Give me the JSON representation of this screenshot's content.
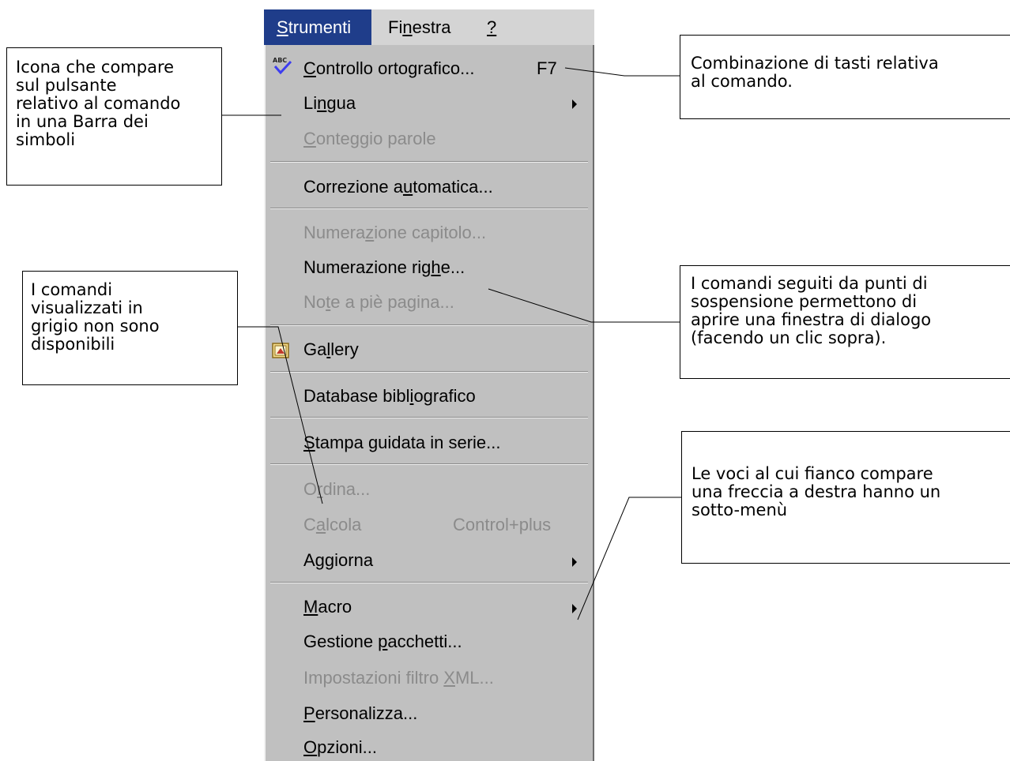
{
  "menubar": {
    "strumenti": {
      "pre": "",
      "u": "S",
      "post": "trumenti"
    },
    "finestra": {
      "pre": "Fi",
      "u": "n",
      "post": "estra"
    },
    "help": {
      "pre": "",
      "u": "?",
      "post": ""
    }
  },
  "menu": {
    "items": [
      {
        "pre": "",
        "u": "C",
        "post": "ontrollo ortografico...",
        "shortcut": "F7",
        "disabled": false,
        "icon": "abc-spellcheck-icon"
      },
      {
        "pre": "Li",
        "u": "n",
        "post": "gua",
        "disabled": false,
        "submenu": true
      },
      {
        "pre": "",
        "u": "C",
        "post": "onteggio parole",
        "disabled": true
      },
      {
        "pre": "Correzione a",
        "u": "u",
        "post": "tomatica...",
        "disabled": false
      },
      {
        "pre": "Numera",
        "u": "z",
        "post": "ione capitolo...",
        "disabled": true
      },
      {
        "pre": "Numerazione rig",
        "u": "h",
        "post": "e...",
        "disabled": false
      },
      {
        "pre": "No",
        "u": "t",
        "post": "e a piè pagina...",
        "disabled": true
      },
      {
        "pre": "Ga",
        "u": "l",
        "post": "lery",
        "disabled": false,
        "icon": "gallery-icon"
      },
      {
        "pre": "Database bibl",
        "u": "i",
        "post": "ografico",
        "disabled": false
      },
      {
        "pre": "",
        "u": "S",
        "post": "tampa guidata in serie...",
        "disabled": false
      },
      {
        "pre": "O",
        "u": "r",
        "post": "dina...",
        "disabled": true
      },
      {
        "pre": "C",
        "u": "a",
        "post": "lcola",
        "shortcut": "Control+plus",
        "disabled": true
      },
      {
        "pre": "Aggiorna",
        "u": "",
        "post": "",
        "disabled": false,
        "submenu": true
      },
      {
        "pre": "",
        "u": "M",
        "post": "acro",
        "disabled": false,
        "submenu": true
      },
      {
        "pre": "Gestione ",
        "u": "p",
        "post": "acchetti...",
        "disabled": false
      },
      {
        "pre": "Impostazioni filtro ",
        "u": "X",
        "post": "ML...",
        "disabled": true
      },
      {
        "pre": "",
        "u": "P",
        "post": "ersonalizza...",
        "disabled": false
      },
      {
        "pre": "",
        "u": "O",
        "post": "pzioni...",
        "disabled": false
      }
    ]
  },
  "callouts": {
    "icon_note": "Icona che compare\nsul pulsante\nrelativo al comando\nin una Barra dei\nsimboli",
    "shortcut_note": "Combinazione di tasti relativa\nal comando.",
    "disabled_note": "I comandi\nvisualizzati in\ngrigio non sono\ndisponibili",
    "ellipsis_note": "I comandi seguiti da punti di\nsospensione permettono di\naprire una finestra di dialogo\n(facendo un clic sopra).",
    "submenu_note": "Le voci al cui fianco compare\nuna freccia a destra hanno un\nsotto-menù"
  },
  "colors": {
    "menubar_active": "#1f3d8a",
    "menu_bg": "#c0c0c0",
    "disabled_text": "#8b8b8b"
  }
}
